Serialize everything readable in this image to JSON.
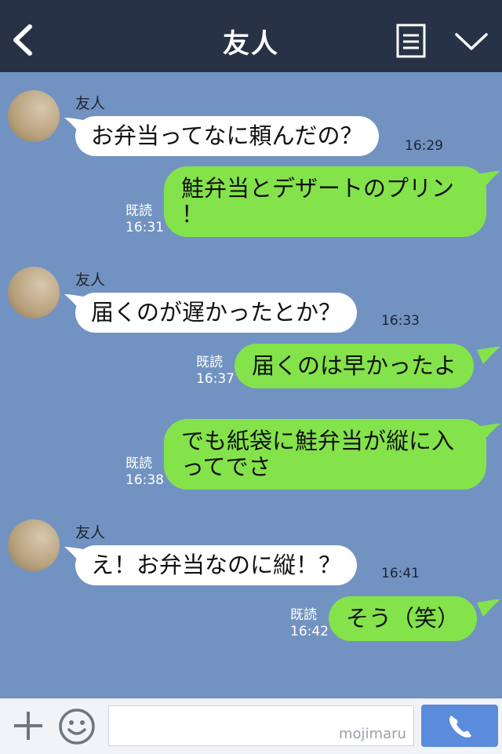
{
  "header": {
    "title": "友人"
  },
  "messages": [
    {
      "type": "in",
      "sender": "友人",
      "text": "お弁当ってなに頼んだの？",
      "time": "16:29"
    },
    {
      "type": "out",
      "read": "既読",
      "text": "鮭弁当とデザートのプリン\n！",
      "time": "16:31"
    },
    {
      "type": "in",
      "sender": "友人",
      "text": "届くのが遅かったとか？",
      "time": "16:33"
    },
    {
      "type": "out",
      "read": "既読",
      "text": "届くのは早かったよ",
      "time": "16:37"
    },
    {
      "type": "out",
      "read": "既読",
      "text": "でも紙袋に鮭弁当が縦に入\nってでさ",
      "time": "16:38"
    },
    {
      "type": "in",
      "sender": "友人",
      "text": "え！お弁当なのに縦！？",
      "time": "16:41"
    },
    {
      "type": "out",
      "read": "既読",
      "text": "そう（笑）",
      "time": "16:42"
    }
  ],
  "footer": {
    "input_value": "",
    "watermark": "mojimaru"
  },
  "colors": {
    "header_bg": "#273246",
    "chat_bg": "#7293c1",
    "incoming_bubble": "#ffffff",
    "outgoing_bubble": "#84e34a",
    "call_button": "#5b8bdb"
  },
  "icons": {
    "back": "chevron-left-icon",
    "menu": "document-icon",
    "collapse": "chevron-down-icon",
    "plus": "plus-icon",
    "emoji": "smiley-icon",
    "call": "phone-icon"
  }
}
